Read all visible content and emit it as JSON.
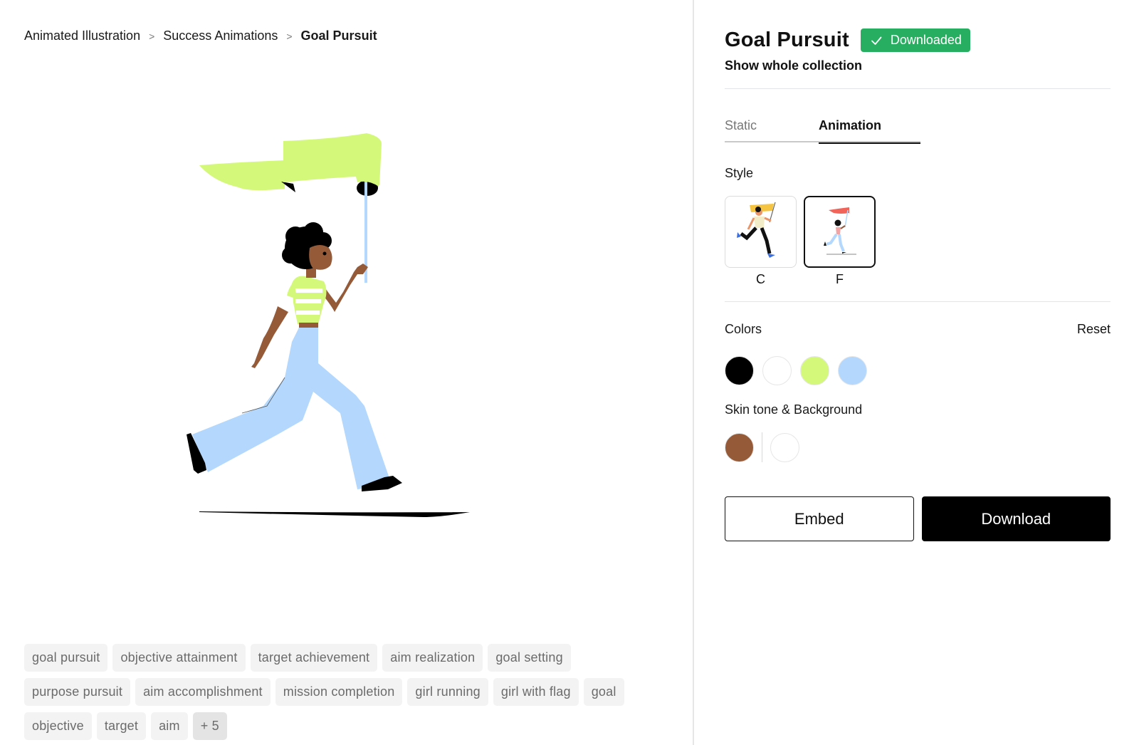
{
  "breadcrumb": {
    "items": [
      "Animated Illustration",
      "Success Animations",
      "Goal Pursuit"
    ],
    "separator": ">"
  },
  "illustration": {
    "subject": "girl running with flag",
    "colors": {
      "flag": "#d4f87a",
      "flag_shadow": "#000000",
      "pole": "#b3d7fd",
      "skin": "#955a38",
      "hair": "#000000",
      "pants": "#b3d7fd",
      "shoes": "#000000",
      "shirt": "#d4f87a",
      "shirt_stripe": "#ffffff",
      "ground": "#000000"
    }
  },
  "tags": [
    "goal pursuit",
    "objective attainment",
    "target achievement",
    "aim realization",
    "goal setting",
    "purpose pursuit",
    "aim accomplishment",
    "mission completion",
    "girl running",
    "girl with flag",
    "goal",
    "objective",
    "target",
    "aim"
  ],
  "tags_more": "+ 5",
  "panel": {
    "title": "Goal Pursuit",
    "badge": {
      "label": "Downloaded",
      "icon": "check-icon",
      "color": "#27ae60"
    },
    "show_collection": "Show whole collection",
    "tabs": [
      {
        "label": "Static",
        "active": false
      },
      {
        "label": "Animation",
        "active": true
      }
    ],
    "style": {
      "label": "Style",
      "options": [
        {
          "name": "C",
          "selected": false
        },
        {
          "name": "F",
          "selected": true
        }
      ]
    },
    "colors": {
      "label": "Colors",
      "reset": "Reset",
      "swatches": [
        "#000000",
        "#ffffff",
        "#d4f87a",
        "#b3d7fd"
      ]
    },
    "skin_bg": {
      "label": "Skin tone & Background",
      "skin": "#955a38",
      "background": "#ffffff"
    },
    "buttons": {
      "embed": "Embed",
      "download": "Download"
    }
  }
}
